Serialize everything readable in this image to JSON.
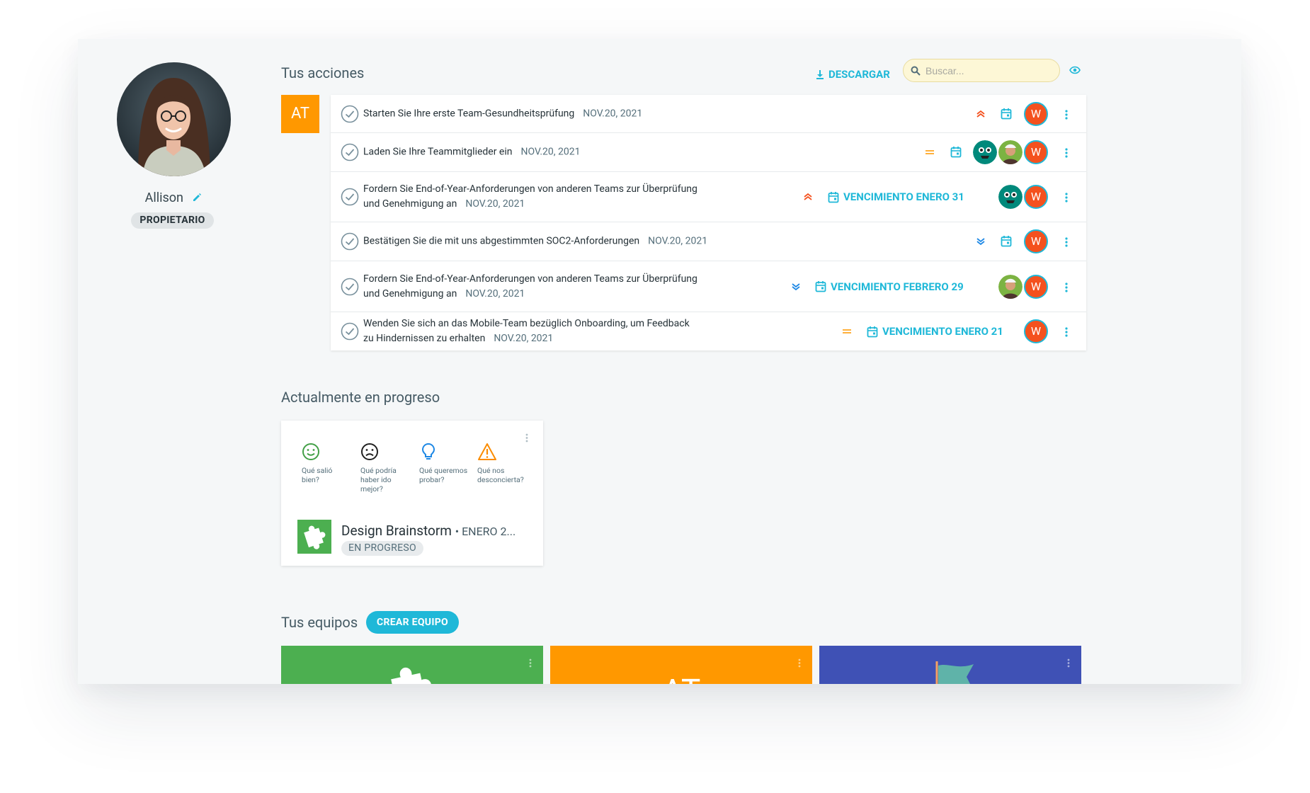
{
  "profile": {
    "name": "Allison",
    "role": "PROPIETARIO"
  },
  "actions_section": {
    "title": "Tus acciones",
    "download_label": "DESCARGAR",
    "search_placeholder": "Buscar...",
    "team_badge": "AT",
    "rows": [
      {
        "line1": "Starten Sie Ihre erste Team-Gesundheitsprüfung",
        "line2": "",
        "date": "NOV.20, 2021",
        "priority": "high",
        "due": "",
        "assignee": "W"
      },
      {
        "line1": "Laden Sie Ihre Teammitglieder ein",
        "line2": "",
        "date": "NOV.20, 2021",
        "priority": "medium",
        "due": "",
        "assignee": "W"
      },
      {
        "line1": "Fordern Sie End-of-Year-Anforderungen von anderen Teams zur Überprüfung",
        "line2": "und Genehmigung an",
        "date": "NOV.20, 2021",
        "priority": "high",
        "due": "VENCIMIENTO ENERO 31",
        "assignee": "W"
      },
      {
        "line1": "Bestätigen Sie die mit uns abgestimmten SOC2-Anforderungen",
        "line2": "",
        "date": "NOV.20, 2021",
        "priority": "low",
        "due": "",
        "assignee": "W"
      },
      {
        "line1": "Fordern Sie End-of-Year-Anforderungen von anderen Teams zur Überprüfung",
        "line2": "und Genehmigung an",
        "date": "NOV.20, 2021",
        "priority": "low",
        "due": "VENCIMIENTO FEBRERO 29",
        "assignee": "W"
      },
      {
        "line1": "Wenden Sie sich an das Mobile-Team bezüglich Onboarding, um Feedback",
        "line2": "zu Hindernissen zu erhalten",
        "date": "NOV.20, 2021",
        "priority": "medium",
        "due": "VENCIMIENTO ENERO 21",
        "assignee": "W"
      }
    ]
  },
  "progress_section": {
    "title": "Actualmente en progreso",
    "card": {
      "columns": [
        "Qué salió bien?",
        "Qué podría haber ido mejor?",
        "Qué queremos probar?",
        "Qué nos desconcierta?"
      ],
      "title": "Design Brainstorm",
      "date": "• ENERO 2...",
      "status": "EN PROGRESO"
    }
  },
  "teams_section": {
    "title": "Tus equipos",
    "create_label": "CREAR EQUIPO",
    "teams": [
      {
        "color": "#4caf50",
        "icon": "puzzle-icon"
      },
      {
        "color": "#ff9800",
        "initials": "AT"
      },
      {
        "color": "#3f51b5",
        "icon": "flag-icon"
      }
    ]
  },
  "colors": {
    "accent": "#1fb8d8",
    "high_priority": "#f4511e",
    "medium_priority": "#ffa726",
    "low_priority": "#1e88e5",
    "assignee": "#f4511e"
  }
}
